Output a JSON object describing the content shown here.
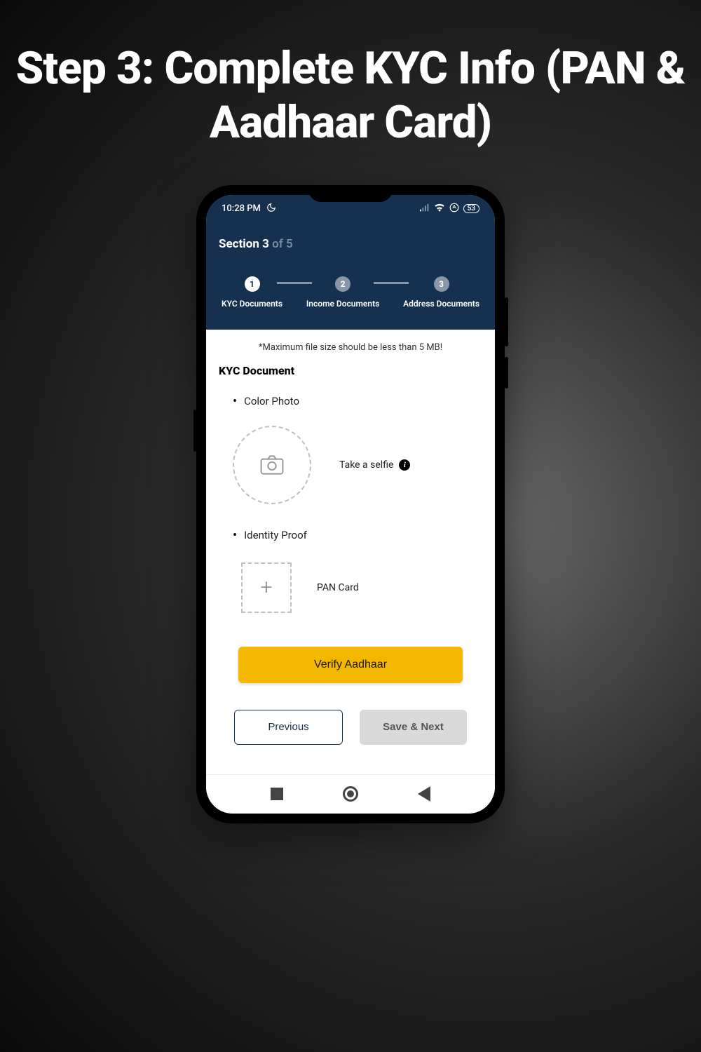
{
  "page_title": "Step 3: Complete KYC Info (PAN & Aadhaar Card)",
  "status_bar": {
    "time": "10:28 PM",
    "battery": "53"
  },
  "header": {
    "section_prefix": "Section 3",
    "section_suffix": " of 5",
    "steps": [
      {
        "num": "1",
        "label": "KYC Documents"
      },
      {
        "num": "2",
        "label": "Income Documents"
      },
      {
        "num": "3",
        "label": "Address Documents"
      }
    ]
  },
  "content": {
    "filesize_note": "*Maximum file size should be less than 5 MB!",
    "section_heading": "KYC Document",
    "color_photo_label": "Color Photo",
    "take_selfie_label": "Take a selfie",
    "identity_proof_label": "Identity Proof",
    "pan_card_label": "PAN Card",
    "verify_button": "Verify Aadhaar",
    "previous_button": "Previous",
    "save_next_button": "Save & Next"
  }
}
